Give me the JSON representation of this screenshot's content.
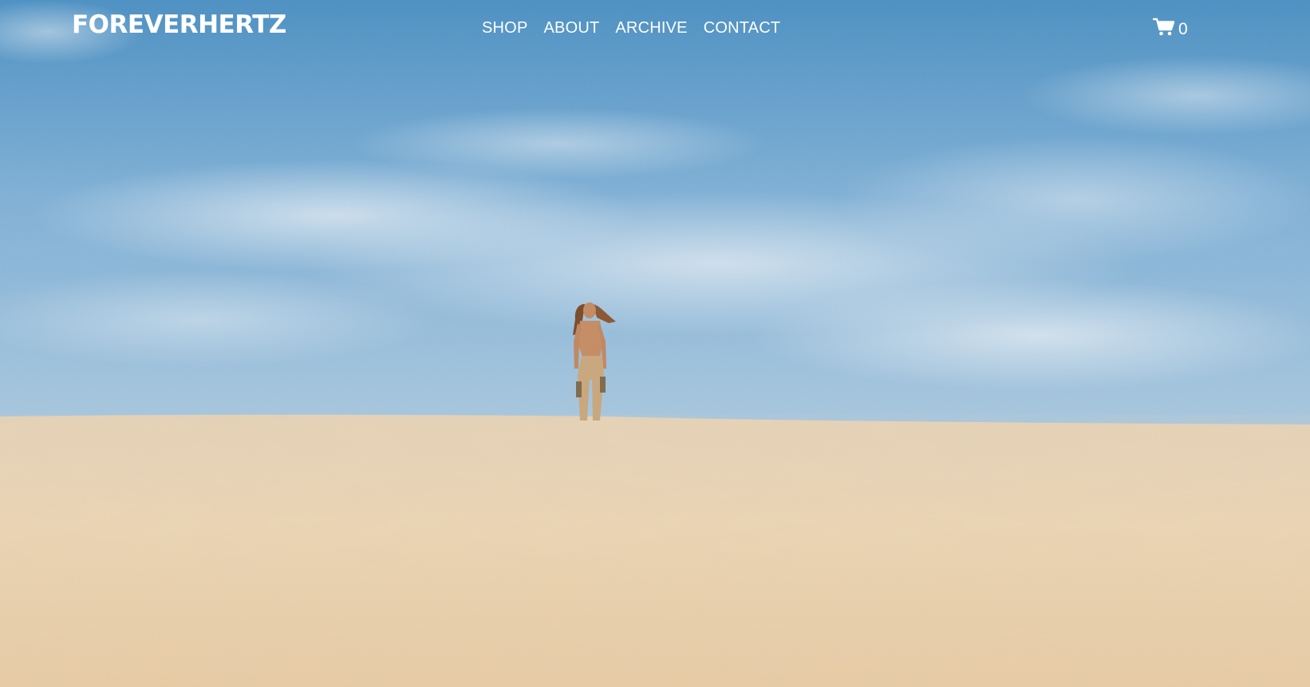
{
  "site": {
    "brand": "FOREVERHERTZ"
  },
  "nav": {
    "items": [
      {
        "label": "SHOP"
      },
      {
        "label": "ABOUT"
      },
      {
        "label": "ARCHIVE"
      },
      {
        "label": "CONTACT"
      }
    ]
  },
  "cart": {
    "icon": "cart-icon",
    "count": "0"
  },
  "colors": {
    "sky_top": "#4f94c6",
    "sky_bottom": "#9cc0dc",
    "sand": "#e9d2b0",
    "text": "#ffffff"
  },
  "hero": {
    "image": "person-standing-on-sand-dune-photo"
  }
}
